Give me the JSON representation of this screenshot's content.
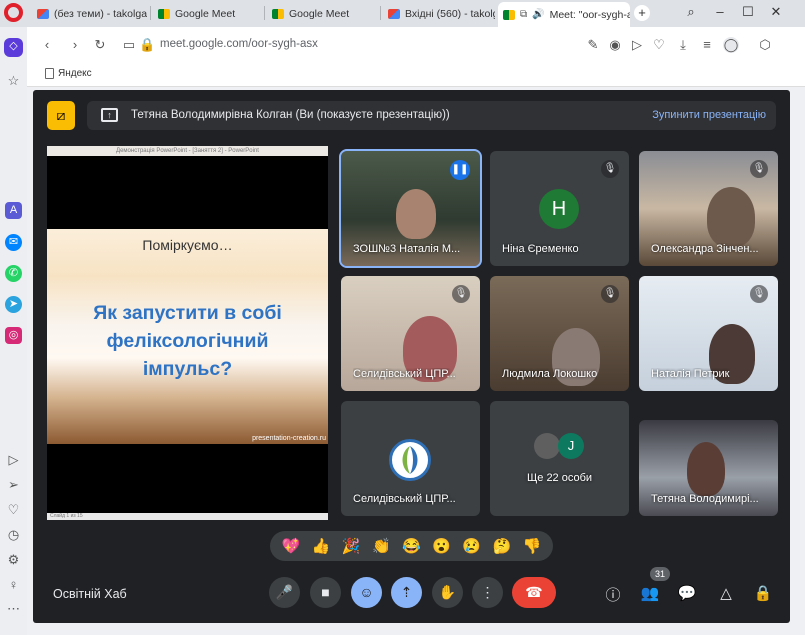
{
  "browser": {
    "tabs": [
      {
        "label": "(без теми) - takolgan",
        "icon": "gmail-icon"
      },
      {
        "label": "Google Meet",
        "icon": "meet-icon"
      },
      {
        "label": "Google Meet",
        "icon": "meet-icon"
      },
      {
        "label": "Вхідні (560) - takolgan",
        "icon": "gmail-icon"
      },
      {
        "label": "Meet: \"oor-sygh-a",
        "icon": "meet-icon",
        "active": true
      }
    ],
    "new_tab": "+",
    "url": "meet.google.com/oor-sygh-asx",
    "bookmark": "Яндекс"
  },
  "meet": {
    "banner": {
      "text": "Тетяна Володимирівна Колган (Ви (показуєте презентацію))",
      "stop_label": "Зупинити презентацію"
    },
    "slide": {
      "window_title": "Демонстрація PowerPoint - [Заняття 2] - PowerPoint",
      "subtitle": "Поміркуємо…",
      "question": "Як запустити  в собі\nфеліксологічний\nімпульс?",
      "url": "presentation-creation.ru",
      "status": "Слайд 1 из 15"
    },
    "participants": [
      {
        "name": "ЗОШ№3 Наталія М...",
        "speaking": true
      },
      {
        "name": "Ніна Єременко",
        "avatar_letter": "Н",
        "avatar_color": "#1e7a34"
      },
      {
        "name": "Олександра Зінчен..."
      },
      {
        "name": "Селидівський ЦПР..."
      },
      {
        "name": "Людмила Локошко"
      },
      {
        "name": "Наталія Петрик"
      },
      {
        "name": "Селидівський ЦПР..."
      },
      {
        "name": "Ще 22 особи",
        "avatar_letter": "J",
        "avatar_color": "#0d7a5f"
      },
      {
        "name": "Тетяна Володимирі..."
      }
    ],
    "reactions": [
      "💖",
      "👍",
      "🎉",
      "👏",
      "😂",
      "😮",
      "😢",
      "🤔",
      "👎"
    ],
    "meeting_name": "Освітній Хаб",
    "people_count": "31"
  }
}
